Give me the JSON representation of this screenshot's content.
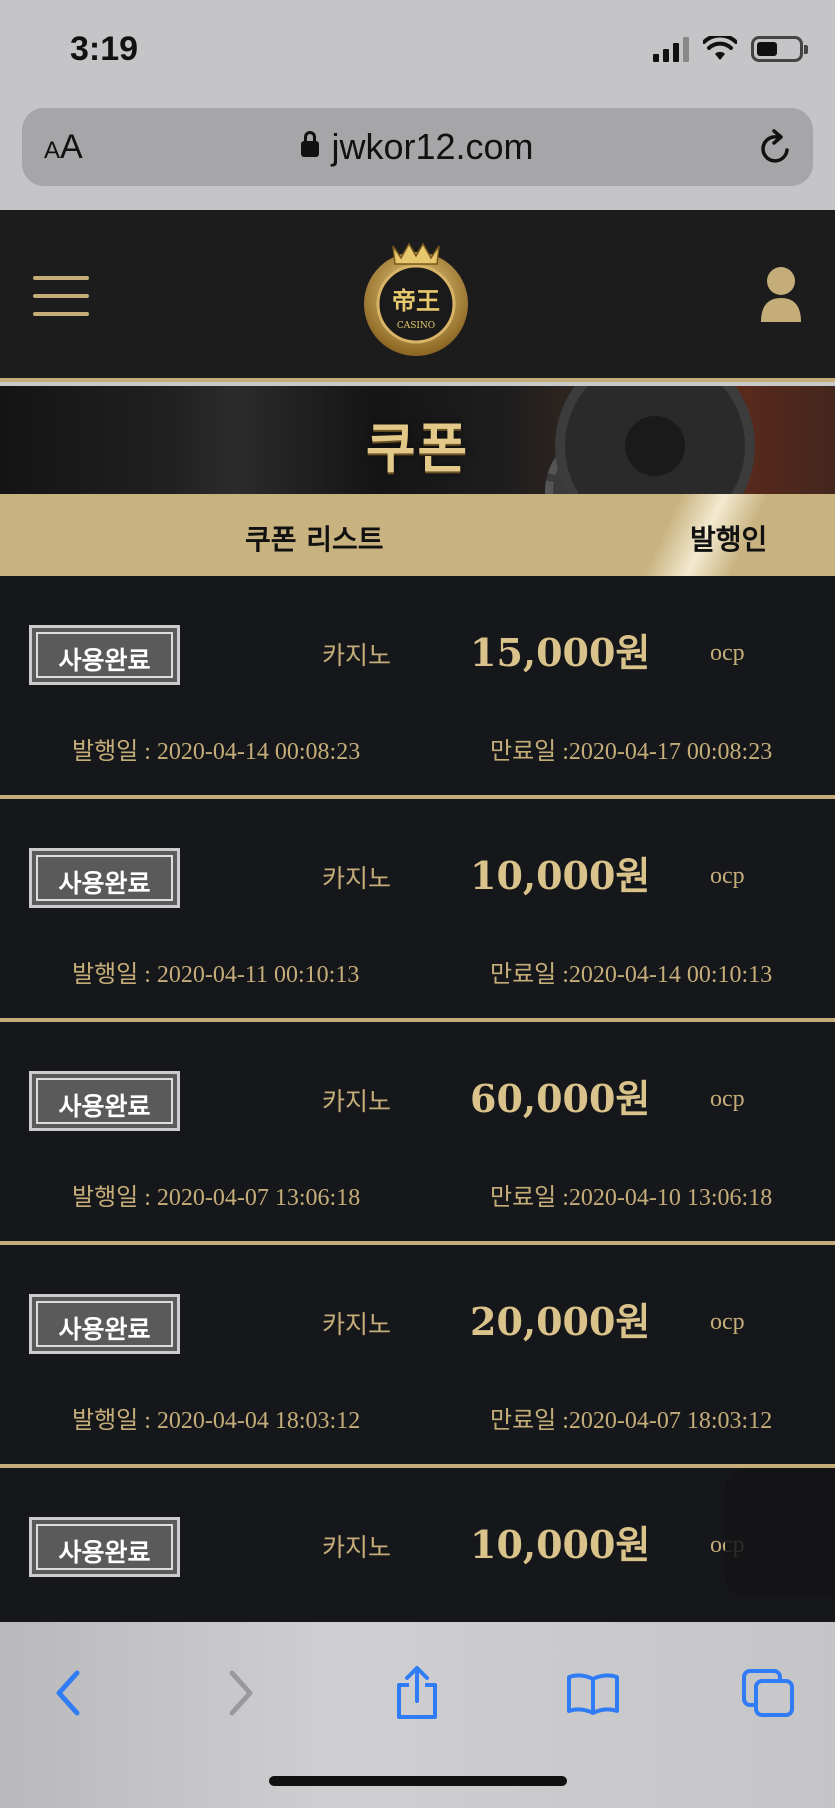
{
  "status_bar": {
    "time": "3:19"
  },
  "browser": {
    "text_size_button": "AA",
    "url": "jwkor12.com"
  },
  "site": {
    "logo_icon": "crown-laurel-casino-logo"
  },
  "banner": {
    "title": "쿠폰"
  },
  "list_header": {
    "left": "쿠폰 리스트",
    "right": "발행인"
  },
  "coupons": [
    {
      "status": "사용완료",
      "game": "카지노",
      "amount": "15,000원",
      "issuer": "ocp",
      "issued": "발행일 : 2020-04-14 00:08:23",
      "expires": "만료일 :2020-04-17 00:08:23"
    },
    {
      "status": "사용완료",
      "game": "카지노",
      "amount": "10,000원",
      "issuer": "ocp",
      "issued": "발행일 : 2020-04-11 00:10:13",
      "expires": "만료일 :2020-04-14 00:10:13"
    },
    {
      "status": "사용완료",
      "game": "카지노",
      "amount": "60,000원",
      "issuer": "ocp",
      "issued": "발행일 : 2020-04-07 13:06:18",
      "expires": "만료일 :2020-04-10 13:06:18"
    },
    {
      "status": "사용완료",
      "game": "카지노",
      "amount": "20,000원",
      "issuer": "ocp",
      "issued": "발행일 : 2020-04-04 18:03:12",
      "expires": "만료일 :2020-04-07 18:03:12"
    },
    {
      "status": "사용완료",
      "game": "카지노",
      "amount": "10,000원",
      "issuer": "ocp",
      "issued": "",
      "expires": ""
    }
  ],
  "colors": {
    "gold": "#c4ad78",
    "dark_bg": "#16171b",
    "header_bg": "#1d1c1d",
    "ios_blue": "#2f7cf6"
  }
}
